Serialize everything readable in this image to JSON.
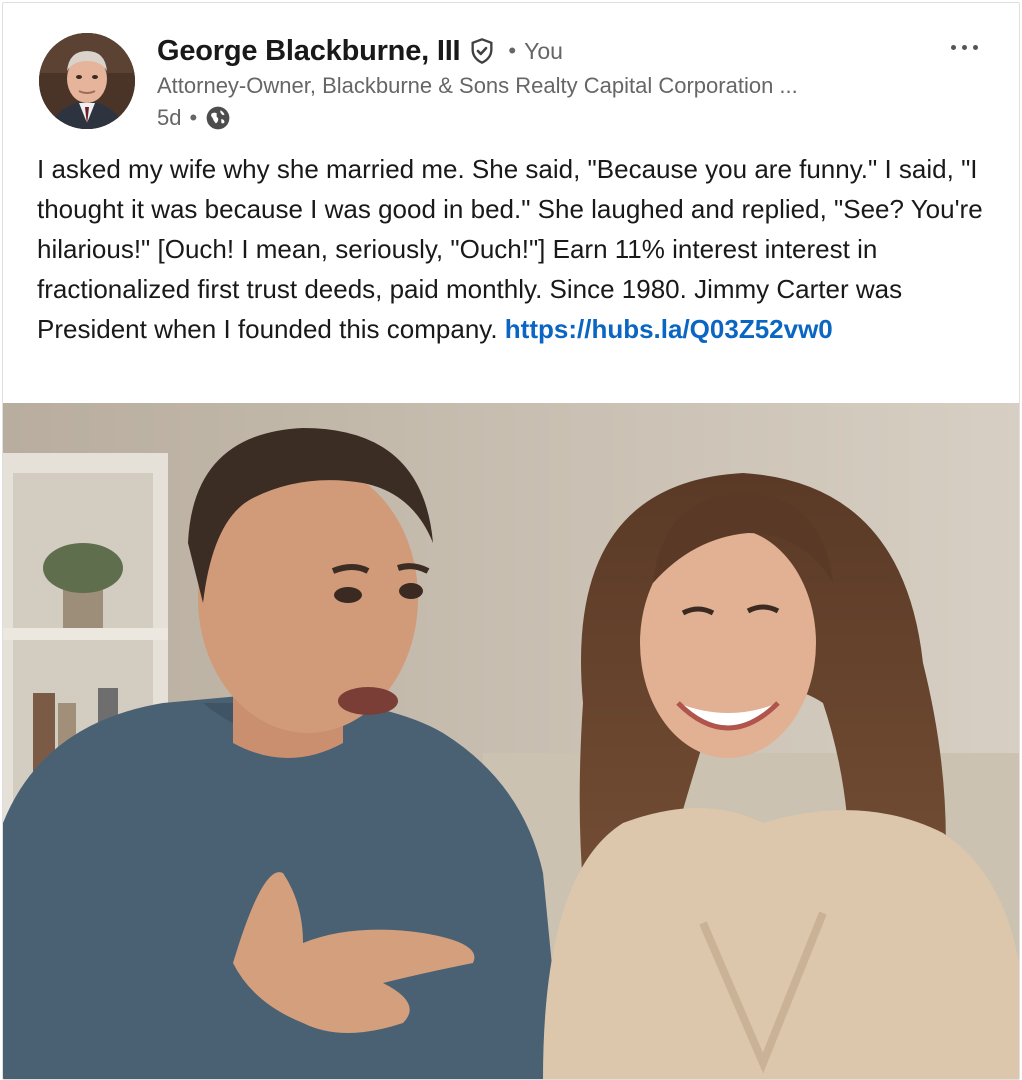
{
  "post": {
    "author_name": "George Blackburne, III",
    "you_separator": "•",
    "you_label": "You",
    "headline": "Attorney-Owner, Blackburne & Sons Realty Capital Corporation ...",
    "age": "5d",
    "age_separator": "•",
    "visibility_icon": "globe-icon",
    "verified_icon": "verified-shield-icon",
    "more_icon": "more-options-icon",
    "text": "I asked my wife why she married me. She said, \"Because you are funny.\" I said, \"I thought it was because I was good in bed.\" She laughed and replied, \"See? You're hilarious!\" [Ouch! I mean, seriously, \"Ouch!\"] Earn 11% interest interest in fractionalized first trust deeds, paid monthly. Since 1980. Jimmy Carter was President when I founded this company. ",
    "link_text": "https://hubs.la/Q03Z52vw0"
  },
  "colors": {
    "link": "#0a66c2",
    "primary_text": "#191919",
    "secondary_text": "#666666"
  }
}
